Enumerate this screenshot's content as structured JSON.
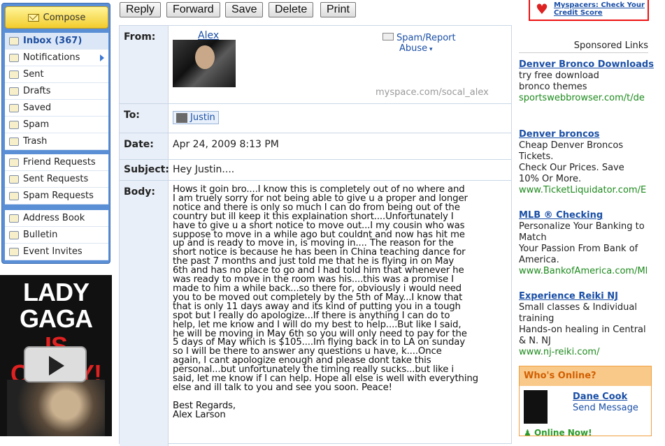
{
  "toolbar": {
    "reply": "Reply",
    "forward": "Forward",
    "save": "Save",
    "delete": "Delete",
    "print": "Print"
  },
  "sidebar": {
    "compose": "Compose",
    "mail": [
      {
        "label": "Inbox (367)",
        "icon": "inbox-icon",
        "active": true
      },
      {
        "label": "Notifications",
        "icon": "notifications-icon",
        "arrow": true
      },
      {
        "label": "Sent",
        "icon": "sent-icon"
      },
      {
        "label": "Drafts",
        "icon": "drafts-icon"
      },
      {
        "label": "Saved",
        "icon": "saved-icon"
      },
      {
        "label": "Spam",
        "icon": "spam-icon"
      },
      {
        "label": "Trash",
        "icon": "trash-icon"
      }
    ],
    "requests": [
      {
        "label": "Friend Requests",
        "icon": "friend-requests-icon"
      },
      {
        "label": "Sent Requests",
        "icon": "sent-requests-icon"
      },
      {
        "label": "Spam Requests",
        "icon": "spam-requests-icon"
      }
    ],
    "tools": [
      {
        "label": "Address Book",
        "icon": "address-book-icon"
      },
      {
        "label": "Bulletin",
        "icon": "bulletin-icon"
      },
      {
        "label": "Event Invites",
        "icon": "event-invites-icon"
      }
    ]
  },
  "left_ad": {
    "line1": "LADY GAGA",
    "line2": "IS CRAZY!"
  },
  "message": {
    "from_label": "From:",
    "from_name": "Alex",
    "spam_report": "Spam/Report",
    "abuse": "Abuse",
    "profile_url": "myspace.com/socal_alex",
    "to_label": "To:",
    "to_name": "Justin",
    "date_label": "Date:",
    "date": "Apr 24, 2009 8:13 PM",
    "subject_label": "Subject:",
    "subject": "Hey Justin....",
    "body_label": "Body:",
    "body": "Hows it goin bro....I know this is completely out of no where and\nI am truely sorry for not being able to give u a proper and longer\nnotice and there is only so much I can do from being out of the\ncountry but ill keep it this explaination short....Unfortunately I\nhave to give u a short notice to move out...I my cousin who was\nsuppose to move in a while ago but couldnt and now has hit me\nup and is ready to move in, is moving in.... The reason for the\nshort notice is because he has been in China teaching dance for\nthe past 7 months and just told me that he is flying in on May\n6th and has no place to go and I had told him that whenever he\nwas ready to move in the room was his....this was a promise I\nmade to him a while back...so there for, obviously i would need\nyou to be moved out completely by the 5th of May...I know that\nthat is only 11 days away and its kind of putting you in a tough\nspot but I really do apologize...If there is anything I can do to\nhelp, let me know and I will do my best to help....But like I said,\nhe will be moving in May 6th so you will only need to pay for the\n5 days of May which is $105....Im flying back in to LA on sunday\nso I will be there to answer any questions u have, k....Once\nagain, I cant apologize enough and please dont take this\npersonal...but unfortunately the timing really sucks...but like i\nsaid, let me know if I can help. Hope all else is well with everything\nelse and ill talk to you and see you soon. Peace!\n\nBest Regards,\nAlex Larson"
  },
  "right": {
    "credit": "Myspacers: Check Your Credit Score",
    "sponsored": "Sponsored Links",
    "ads": [
      {
        "title": "Denver Bronco Downloads",
        "text": "try free download bronco themes",
        "url": "sportswebbrowser.com/t/de"
      },
      {
        "title": "Denver broncos",
        "text": "Cheap Denver Broncos Tickets.",
        "text2": "Check Our Prices. Save 10% Or More.",
        "url": "www.TicketLiquidator.com/E"
      },
      {
        "title": "MLB ® Checking",
        "text": "Personalize Your Banking to Match",
        "text2": "Your Passion From Bank of America.",
        "url": "www.BankofAmerica.com/Ml"
      },
      {
        "title": "Experience Reiki NJ",
        "text": "Small classes & Individual training",
        "text2": "Hands-on healing in Central & N. NJ",
        "url": "www.nj-reiki.com/"
      }
    ],
    "who": {
      "title": "Who's Online?",
      "name": "Dane Cook",
      "send": "Send Message",
      "online": "Online Now!"
    }
  }
}
